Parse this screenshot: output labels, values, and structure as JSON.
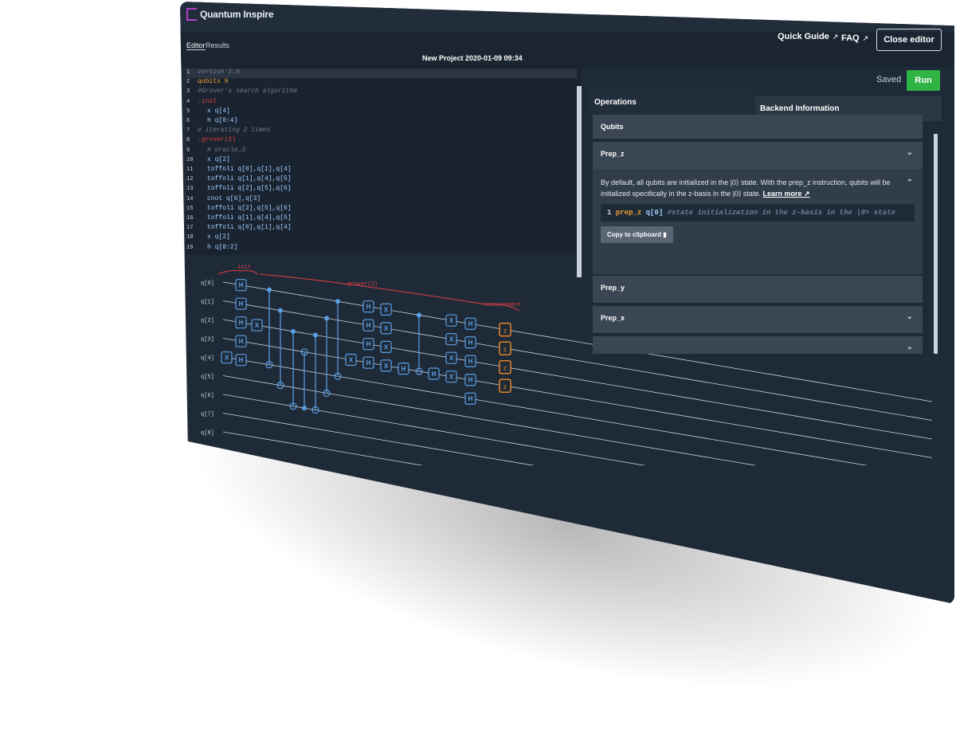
{
  "app": {
    "name": "Quantum Inspire"
  },
  "tabs": [
    {
      "label": "Editor",
      "active": true
    },
    {
      "label": "Results",
      "active": false
    }
  ],
  "project_title": "New Project 2020-01-09 09:34",
  "nav": {
    "quick_guide": "Quick Guide",
    "faq": "FAQ",
    "close_editor": "Close editor",
    "external_icon": "↗"
  },
  "status": {
    "saved": "Saved",
    "run": "Run"
  },
  "editor": {
    "lines": [
      {
        "n": "1",
        "text": "version 1.0",
        "color": "#6f7f91",
        "italic": true,
        "indent": 0
      },
      {
        "n": "2",
        "text": "qubits 9",
        "color": "#f0a030",
        "italic": false,
        "indent": 0
      },
      {
        "n": "3",
        "text": "#Grover's search algorithm",
        "color": "#6f7f91",
        "italic": true,
        "indent": 0
      },
      {
        "n": "4",
        "text": ".init",
        "color": "#e04040",
        "italic": false,
        "indent": 0
      },
      {
        "n": "5",
        "text": "x q[4]",
        "color": "#9fd0ff",
        "italic": false,
        "indent": 2
      },
      {
        "n": "6",
        "text": "h q[0:4]",
        "color": "#9fd0ff",
        "italic": false,
        "indent": 2
      },
      {
        "n": "7",
        "text": "# iterating 2 times",
        "color": "#6f7f91",
        "italic": true,
        "indent": 0
      },
      {
        "n": "8",
        "text": ".grover(2)",
        "color": "#e04040",
        "italic": false,
        "indent": 0
      },
      {
        "n": "9",
        "text": "# oracle_3",
        "color": "#6f7f91",
        "italic": true,
        "indent": 2
      },
      {
        "n": "10",
        "text": "x q[2]",
        "color": "#9fd0ff",
        "italic": false,
        "indent": 2
      },
      {
        "n": "11",
        "text": "toffoli q[0],q[1],q[4]",
        "color": "#9fd0ff",
        "italic": false,
        "indent": 2
      },
      {
        "n": "12",
        "text": "toffoli q[1],q[4],q[5]",
        "color": "#9fd0ff",
        "italic": false,
        "indent": 2
      },
      {
        "n": "13",
        "text": "toffoli q[2],q[5],q[6]",
        "color": "#9fd0ff",
        "italic": false,
        "indent": 2
      },
      {
        "n": "14",
        "text": "cnot q[6],q[3]",
        "color": "#9fd0ff",
        "italic": false,
        "indent": 2
      },
      {
        "n": "15",
        "text": "toffoli q[2],q[5],q[6]",
        "color": "#9fd0ff",
        "italic": false,
        "indent": 2
      },
      {
        "n": "16",
        "text": "toffoli q[1],q[4],q[5]",
        "color": "#9fd0ff",
        "italic": false,
        "indent": 2
      },
      {
        "n": "17",
        "text": "toffoli q[0],q[1],q[4]",
        "color": "#9fd0ff",
        "italic": false,
        "indent": 2
      },
      {
        "n": "18",
        "text": "x q[2]",
        "color": "#9fd0ff",
        "italic": false,
        "indent": 2
      },
      {
        "n": "19",
        "text": "h q[0:2]",
        "color": "#9fd0ff",
        "italic": false,
        "indent": 2
      }
    ]
  },
  "circuit": {
    "qubits": [
      "q[0]",
      "q[1]",
      "q[2]",
      "q[3]",
      "q[4]",
      "q[5]",
      "q[6]",
      "q[7]",
      "q[8]"
    ],
    "sections": [
      {
        "label": ".init"
      },
      {
        "label": ".grover(2)"
      },
      {
        "label": ".measurement"
      }
    ],
    "gate_color": "#5aa0e6",
    "measure_color": "#f08a24",
    "section_color": "#e04040"
  },
  "panel": {
    "tabs": {
      "operations": "Operations",
      "backend": "Backend Information"
    },
    "items": [
      {
        "title": "Qubits"
      },
      {
        "title": "Prep_z",
        "expanded": true,
        "description": "By default, all qubits are initialized in the |0⟩ state. With the prep_z instruction, qubits will be initialized specifically in the z-basis in the |0⟩ state.",
        "learn_more": "Learn more",
        "code_line_no": "1",
        "code_kw": "prep_z",
        "code_arg": "q[0]",
        "code_comment": "#state initialization in the z-basis in the |0> state",
        "copy_label": "Copy to clipboard"
      },
      {
        "title": "Prep_y"
      },
      {
        "title": "Prep_x"
      }
    ]
  }
}
